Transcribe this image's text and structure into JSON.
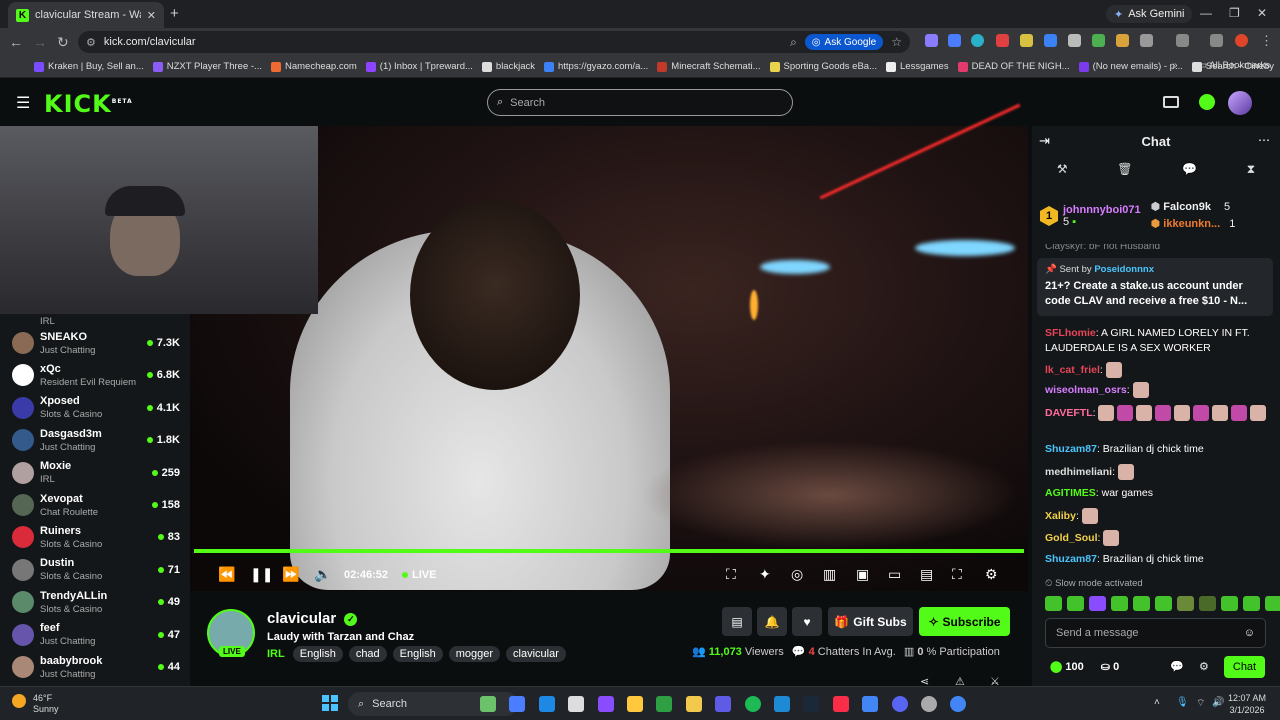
{
  "browser": {
    "tab_title": "clavicular Stream - Watch L",
    "tab_close": "✕",
    "new_tab": "+",
    "ask_gemini": "Ask Gemini",
    "url": "kick.com/clavicular",
    "ask_google": "Ask Google",
    "bookmarks": [
      {
        "label": "Kraken | Buy, Sell an...",
        "color": "#7a4cff"
      },
      {
        "label": "NZXT Player Three -...",
        "color": "#8b5cf6"
      },
      {
        "label": "Namecheap.com",
        "color": "#f06a33"
      },
      {
        "label": "(1) Inbox | Tpreward...",
        "color": "#8c44ff"
      },
      {
        "label": "blackjack",
        "color": "#dddddd"
      },
      {
        "label": "https://gyazo.com/a...",
        "color": "#3b82f6"
      },
      {
        "label": "Minecraft Schemati...",
        "color": "#c0392b"
      },
      {
        "label": "Sporting Goods eBa...",
        "color": "#e8d44d"
      },
      {
        "label": "Lessgames",
        "color": "#eeeeee"
      },
      {
        "label": "DEAD OF THE NIGH...",
        "color": "#e33a6e"
      },
      {
        "label": "(No new emails) - p...",
        "color": "#7c3aed"
      },
      {
        "label": "Search - Cineby",
        "color": "#dddddd"
      }
    ],
    "all_bookmarks": "All Bookmarks"
  },
  "kick": {
    "logo": "KICK",
    "logo_sup": "BETA",
    "search_placeholder": "Search"
  },
  "sidebar": {
    "top_partial_category": "IRL",
    "channels": [
      {
        "name": "SNEAKO",
        "category": "Just Chatting",
        "viewers": "7.3K",
        "color": "#8a6a55"
      },
      {
        "name": "xQc",
        "category": "Resident Evil Requiem",
        "viewers": "6.8K",
        "color": "#ffffff"
      },
      {
        "name": "Xposed",
        "category": "Slots & Casino",
        "viewers": "4.1K",
        "color": "#3a3aa8"
      },
      {
        "name": "Dasgasd3m",
        "category": "Just Chatting",
        "viewers": "1.8K",
        "color": "#335a8a"
      },
      {
        "name": "Moxie",
        "category": "IRL",
        "viewers": "259",
        "color": "#b0a0a0"
      },
      {
        "name": "Xevopat",
        "category": "Chat Roulette",
        "viewers": "158",
        "color": "#556655"
      },
      {
        "name": "Ruiners",
        "category": "Slots & Casino",
        "viewers": "83",
        "color": "#d92b3a"
      },
      {
        "name": "Dustin",
        "category": "Slots & Casino",
        "viewers": "71",
        "color": "#777777"
      },
      {
        "name": "TrendyALLin",
        "category": "Slots & Casino",
        "viewers": "49",
        "color": "#5a8a6a"
      },
      {
        "name": "feef",
        "category": "Just Chatting",
        "viewers": "47",
        "color": "#6655aa"
      },
      {
        "name": "baabybrook",
        "category": "Just Chatting",
        "viewers": "44",
        "color": "#aa8877"
      }
    ]
  },
  "player": {
    "time": "02:46:52",
    "live": "LIVE",
    "progress_fraction": 1.0
  },
  "stream": {
    "channel": "clavicular",
    "live_badge": "LIVE",
    "title": "Laudy with Tarzan and Chaz",
    "category": "IRL",
    "tags": [
      "English",
      "chad",
      "English",
      "mogger",
      "clavicular"
    ],
    "gift_subs": "Gift Subs",
    "subscribe": "Subscribe",
    "viewers": "11,073",
    "viewers_label": "Viewers",
    "chatters": "4",
    "chatters_label": "Chatters In Avg.",
    "participation": "0",
    "participation_label": "% Participation"
  },
  "chat": {
    "title": "Chat",
    "leaderboard": [
      {
        "rank": "1",
        "name": "johnnnyboi071",
        "count": "5"
      },
      {
        "name": "Falcon9k",
        "count": "5"
      },
      {
        "name": "ikkeunkn...",
        "count": "1"
      }
    ],
    "cut_line": "Clayskyr: bF not Husband",
    "pinned_by": "Sent by",
    "pinned_user": "Poseidonnnx",
    "pinned_message": "21+? Create a stake.us account under code CLAV and receive a free $10 - N...",
    "messages": [
      {
        "user": "SFLhomie",
        "text": "A GIRL NAMED LORELY IN FT. LAUDERDALE IS A SEX WORKER",
        "color": "#e8455a"
      },
      {
        "user": "lk_cat_friel",
        "text": "",
        "color": "#e8455a"
      },
      {
        "user": "wiseolman_osrs",
        "text": "",
        "color": "#d77dff"
      },
      {
        "user": "DAVEFTL",
        "text": "",
        "color": "#ff6b9d"
      },
      {
        "user": "Shuzam87",
        "text": "Brazilian dj chick time",
        "color": "#49c6ff"
      },
      {
        "user": "medhimeliani",
        "text": "",
        "color": "#dddddd"
      },
      {
        "user": "AGITIMES",
        "text": "war games",
        "color": "#53fc18"
      },
      {
        "user": "Xaliby",
        "text": "",
        "color": "#f2d14a"
      },
      {
        "user": "Gold_Soul",
        "text": "",
        "color": "#f2d14a"
      },
      {
        "user": "Shuzam87",
        "text": "Brazilian dj chick time",
        "color": "#49c6ff"
      }
    ],
    "slow_mode": "Slow mode activated",
    "send_placeholder": "Send a message",
    "points": "100",
    "drops": "0",
    "chat_button": "Chat"
  },
  "taskbar": {
    "temp": "46°F",
    "weather": "Sunny",
    "search": "Search",
    "time": "12:07 AM",
    "date": "3/1/2026"
  }
}
